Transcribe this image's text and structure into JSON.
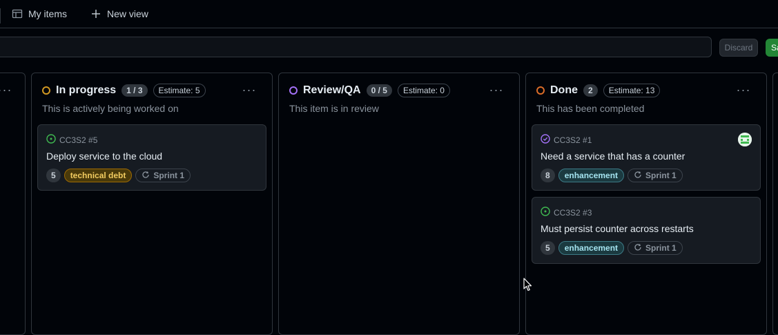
{
  "tabs": [
    {
      "label": "My items",
      "icon": "table-icon"
    },
    {
      "label": "New view",
      "icon": "plus-icon"
    }
  ],
  "filter": {
    "discard_label": "Discard",
    "save_label": "Sa"
  },
  "columns": [
    {
      "title": "In progress",
      "count": "1 / 3",
      "estimate": "Estimate: 5",
      "description": "This is actively being worked on",
      "status_color": "#d29922",
      "cards": [
        {
          "ref": "CC3S2 #5",
          "title": "Deploy service to the cloud",
          "points": "5",
          "label": "technical debt",
          "label_kind": "debt",
          "sprint": "Sprint 1",
          "state_icon": "issue-open-icon"
        }
      ]
    },
    {
      "title": "Review/QA",
      "count": "0 / 5",
      "estimate": "Estimate: 0",
      "description": "This item is in review",
      "status_color": "#a371f7",
      "cards": []
    },
    {
      "title": "Done",
      "count": "2",
      "estimate": "Estimate: 13",
      "description": "This has been completed",
      "status_color": "#db6d28",
      "cards": [
        {
          "ref": "CC3S2 #1",
          "title": "Need a service that has a counter",
          "points": "8",
          "label": "enhancement",
          "label_kind": "enh",
          "sprint": "Sprint 1",
          "state_icon": "issue-closed-icon",
          "has_avatar": true
        },
        {
          "ref": "CC3S2 #3",
          "title": "Must persist counter across restarts",
          "points": "5",
          "label": "enhancement",
          "label_kind": "enh",
          "sprint": "Sprint 1",
          "state_icon": "issue-open-icon"
        }
      ]
    }
  ],
  "colors": {
    "open": "#3fb950",
    "closed": "#a371f7",
    "accent_green": "#238636"
  }
}
